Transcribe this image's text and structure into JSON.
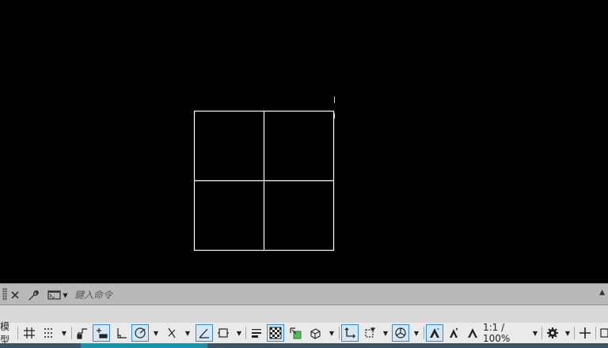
{
  "command_line": {
    "placeholder": "鍵入命令"
  },
  "status_bar": {
    "model_tab_label": "模型",
    "annotation_scale_label": "1:1 / 100%"
  },
  "colors": {
    "canvas": "#000000",
    "drawing_lines": "#ffffff",
    "command_bar": "#b9b9b9",
    "status_bar": "#eaeaea",
    "toggle_on": "#d5e7f5",
    "toggle_border": "#3c8ac8"
  },
  "icons": [
    "grip-handle-icon",
    "close-icon",
    "wrench-icon",
    "command-prompt-icon",
    "chevron-up-icon",
    "grid-icon",
    "snap-icon",
    "infer-constraints-icon",
    "dynamic-input-icon",
    "ortho-icon",
    "polar-tracking-icon",
    "isodraft-icon",
    "object-snap-tracking-icon",
    "object-snap-icon",
    "lineweight-icon",
    "transparency-icon",
    "selection-cycling-icon",
    "3d-object-snap-icon",
    "dynamic-ucs-icon",
    "selection-filter-icon",
    "gizmo-icon",
    "annotation-visibility-icon",
    "auto-scale-icon",
    "annotation-scale-icon",
    "workspace-gear-icon",
    "plus-icon",
    "customize-icon"
  ]
}
